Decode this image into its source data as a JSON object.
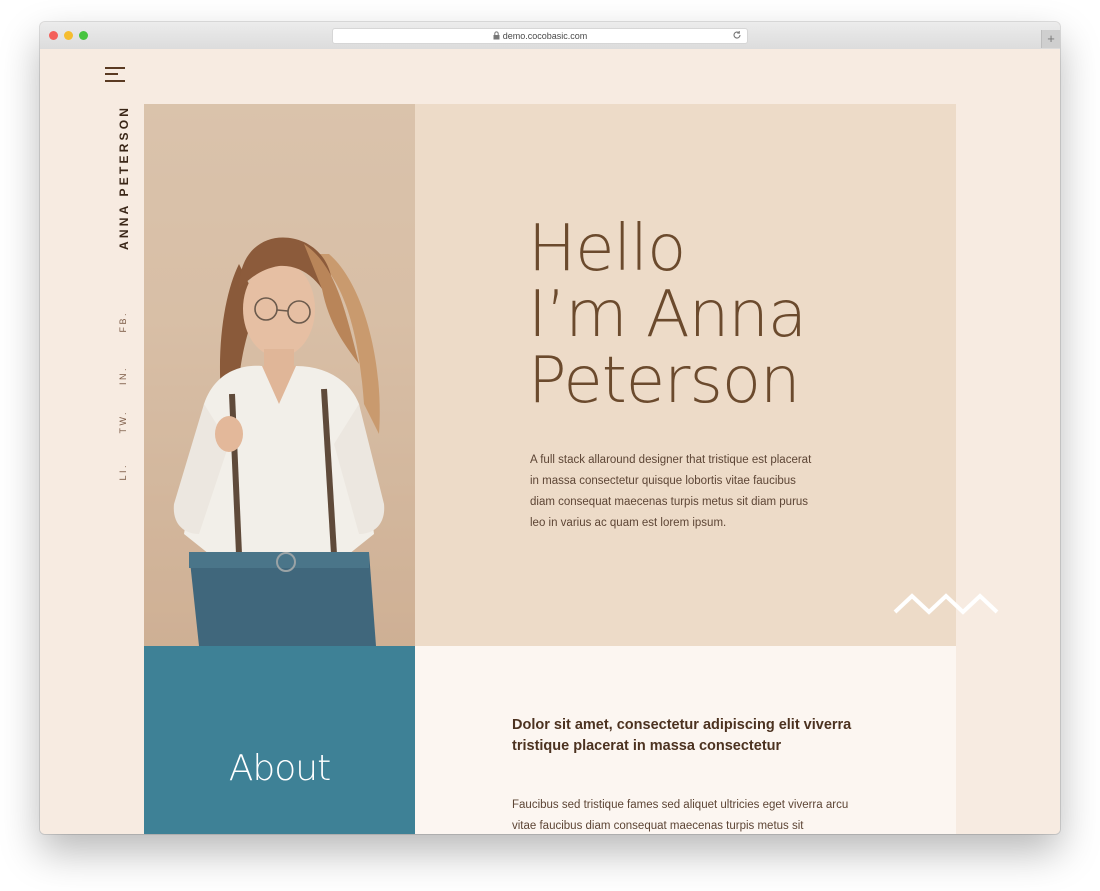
{
  "browser": {
    "url": "demo.cocobasic.com",
    "new_tab": "+"
  },
  "sidebar": {
    "name": "ANNA PETERSON",
    "social": [
      "FB.",
      "IN.",
      "TW.",
      "LI."
    ]
  },
  "hero": {
    "heading_lines": [
      "Hello",
      "I’m Anna",
      "Peterson"
    ],
    "intro": "A full stack allaround designer that tristique est placerat in massa consectetur quisque lobortis vitae faucibus diam consequat maecenas turpis metus sit diam purus leo in varius ac quam est lorem ipsum."
  },
  "about": {
    "title": "About",
    "heading": "Dolor sit amet, consectetur adipiscing elit viverra tristique placerat in massa consectetur",
    "text": "Faucibus sed tristique fames sed aliquet ultricies eget viverra arcu vitae faucibus diam consequat maecenas turpis metus sit"
  },
  "colors": {
    "page_bg": "#f7ebe1",
    "hero_bg": "#eddbc8",
    "about_accent": "#3e8196",
    "text_brown": "#6b4a2d"
  },
  "icons": [
    "menu-icon",
    "lock-icon",
    "reload-icon",
    "zigzag-icon"
  ]
}
